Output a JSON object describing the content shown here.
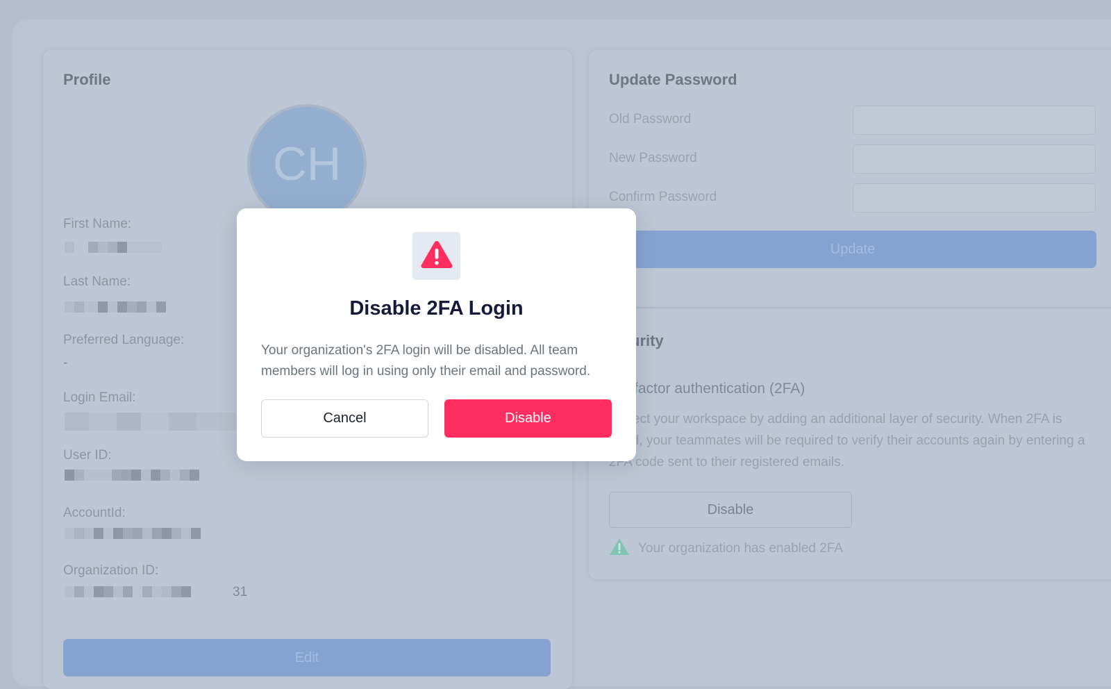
{
  "profile": {
    "title": "Profile",
    "avatar_initials": "CH",
    "fields": {
      "first_name": {
        "label": "First Name:"
      },
      "last_name": {
        "label": "Last Name:"
      },
      "preferred_language": {
        "label": "Preferred Language:",
        "value": "-"
      },
      "login_email": {
        "label": "Login Email:"
      },
      "user_id": {
        "label": "User ID:"
      },
      "account_id": {
        "label": "AccountId:"
      },
      "organization_id": {
        "label": "Organization ID:",
        "value_suffix": "31"
      }
    },
    "edit_label": "Edit"
  },
  "password": {
    "title": "Update Password",
    "old_label": "Old Password",
    "new_label": "New Password",
    "confirm_label": "Confirm Password",
    "update_label": "Update"
  },
  "security": {
    "title_visible": "urity",
    "subtitle_visible": "-factor authentication (2FA)",
    "description_visible": "ect your workspace by adding an additional layer of security. When 2FA is rated, your teammates will be required to verify their accounts again by entering a 2FA code sent to their registered emails.",
    "disable_label": "Disable",
    "status_text": "Your organization has enabled 2FA",
    "status_icon": "warning-triangle-icon"
  },
  "modal": {
    "icon": "warning-triangle-icon",
    "title": "Disable 2FA Login",
    "body": "Your organization's 2FA login will be disabled. All team members will log in using only their email and password.",
    "cancel_label": "Cancel",
    "confirm_label": "Disable"
  },
  "colors": {
    "danger": "#ff2d60",
    "primary_muted": "#85a2d1",
    "title_dark": "#15193a",
    "status_green": "#7fc4b3"
  }
}
